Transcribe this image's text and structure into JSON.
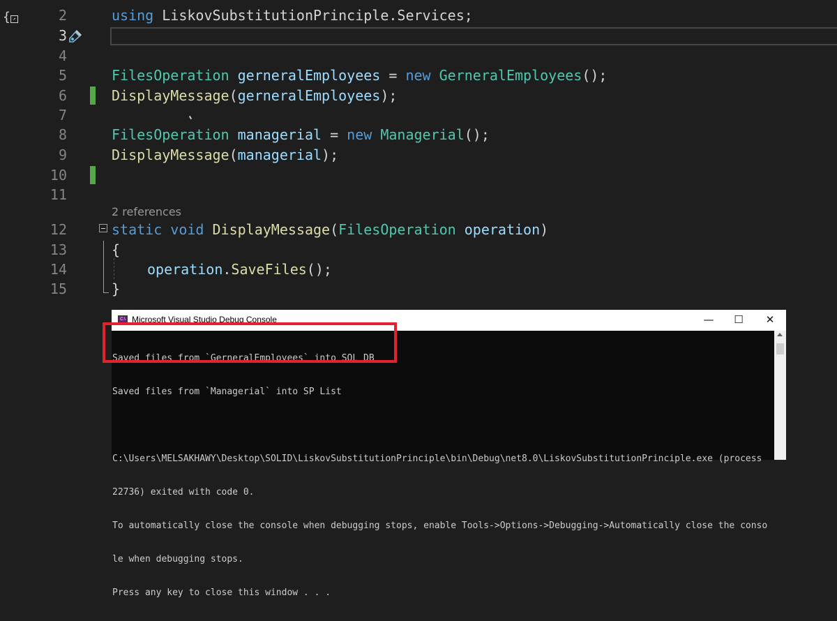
{
  "editor": {
    "lines": [
      {
        "n": "2"
      },
      {
        "n": "3"
      },
      {
        "n": "4"
      },
      {
        "n": "5"
      },
      {
        "n": "6"
      },
      {
        "n": "7"
      },
      {
        "n": "8"
      },
      {
        "n": "9"
      },
      {
        "n": "10"
      },
      {
        "n": "11"
      },
      {
        "n": "12"
      },
      {
        "n": "13"
      },
      {
        "n": "14"
      },
      {
        "n": "15"
      }
    ],
    "code": {
      "l2": {
        "kw": "using",
        "ns": " LiskovSubstitutionPrinciple.Services;"
      },
      "l5": {
        "type": "FilesOperation",
        "var": " gerneralEmployees",
        "eq": " = ",
        "kw": "new",
        "ctor": " GerneralEmployees",
        "end": "();"
      },
      "l6": {
        "fn": "DisplayMessage",
        "open": "(",
        "arg": "gerneralEmployees",
        "close": ");"
      },
      "l8": {
        "type": "FilesOperation",
        "var": " managerial",
        "eq": " = ",
        "kw": "new",
        "ctor": " Managerial",
        "end": "();"
      },
      "l9": {
        "fn": "DisplayMessage",
        "open": "(",
        "arg": "managerial",
        "close": ");"
      },
      "l12": {
        "kw1": "static",
        "kw2": " void",
        "fn": " DisplayMessage",
        "open": "(",
        "type": "FilesOperation",
        "param": " operation",
        "close": ")"
      },
      "l13": "{",
      "l14": {
        "obj": "operation",
        "dot": ".",
        "method": "SaveFiles",
        "end": "();"
      },
      "l15": "}"
    },
    "codelens": "2 references"
  },
  "console": {
    "title": "Microsoft Visual Studio Debug Console",
    "minimize": "—",
    "maximize": "☐",
    "close": "✕",
    "lines": [
      "Saved files from `GerneralEmployees` into SQL DB",
      "Saved files from `Managerial` into SP List",
      "",
      "C:\\Users\\MELSAKHAWY\\Desktop\\SOLID\\LiskovSubstitutionPrinciple\\bin\\Debug\\net8.0\\LiskovSubstitutionPrinciple.exe (process",
      "22736) exited with code 0.",
      "To automatically close the console when debugging stops, enable Tools->Options->Debugging->Automatically close the conso",
      "le when debugging stops.",
      "Press any key to close this window . . ."
    ]
  },
  "colors": {
    "highlight": "#e0232c",
    "keyword": "#569cd6",
    "type": "#4ec9b0",
    "function": "#dcdcaa",
    "variable": "#9cdcfe"
  }
}
